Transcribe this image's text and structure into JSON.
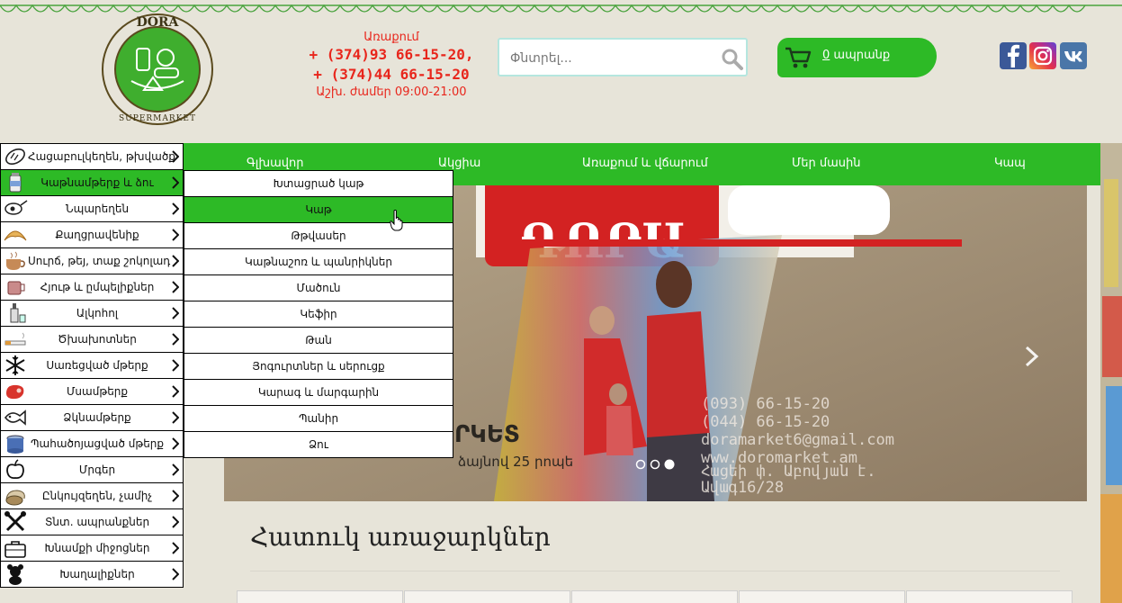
{
  "header": {
    "logo_text_top": "DORA",
    "logo_text_bottom": "SUPERMARKET",
    "delivery_label": "Առաքում",
    "phone_1": "+ (374)93 66-15-20,",
    "phone_2": "+ (374)44 66-15-20",
    "hours": "Աշխ. ժամեր 09:00-21:00",
    "search": {
      "placeholder": "Փնտրել..."
    },
    "cart": {
      "count": "0",
      "label": "ապրանք"
    },
    "social": [
      "facebook-icon",
      "instagram-icon",
      "vk-icon"
    ]
  },
  "nav": {
    "items": [
      "Գլխավոր",
      "Ակցիա",
      "Առաքում և վճարում",
      "Մեր մասին",
      "Կապ"
    ]
  },
  "categories": [
    {
      "label": "Հացաբուլկեղեն, թխվածք",
      "icon": "bread-icon"
    },
    {
      "label": "Կաթնամթերք և ձու",
      "icon": "milk-icon",
      "active": true
    },
    {
      "label": "Նպարեղեն",
      "icon": "grocery-icon"
    },
    {
      "label": "Քաղցրավենիք",
      "icon": "croissant-icon"
    },
    {
      "label": "Սուրճ, թեյ, տաք շոկոլադ",
      "icon": "coffee-icon"
    },
    {
      "label": "Հյութ և ըմպելիքներ",
      "icon": "juice-icon"
    },
    {
      "label": "Ալկոհոլ",
      "icon": "alcohol-icon"
    },
    {
      "label": "Ծխախոտներ",
      "icon": "cigarette-icon"
    },
    {
      "label": "Սառեցված մթերք",
      "icon": "snowflake-icon"
    },
    {
      "label": "Մսամթերք",
      "icon": "meat-icon"
    },
    {
      "label": "Ձկնամթերք",
      "icon": "fish-icon"
    },
    {
      "label": "Պահածոյացված մթերք",
      "icon": "canned-icon"
    },
    {
      "label": "Մրգեր",
      "icon": "apple-icon"
    },
    {
      "label": "Ընկույզեղեն, չամիչ",
      "icon": "nuts-icon"
    },
    {
      "label": "Տնտ. ապրանքներ",
      "icon": "tools-icon"
    },
    {
      "label": "Խնամքի միջոցներ",
      "icon": "care-icon"
    },
    {
      "label": "Խաղալիքներ",
      "icon": "toy-icon"
    }
  ],
  "submenu": [
    {
      "label": "Խտացրած կաթ"
    },
    {
      "label": "Կաթ",
      "active": true
    },
    {
      "label": "Թթվասեր"
    },
    {
      "label": "Կաթնաշոռ և պանրիկներ"
    },
    {
      "label": "Մածուն"
    },
    {
      "label": "Կեֆիր"
    },
    {
      "label": "Թան"
    },
    {
      "label": "Յոգուրտներ և սերուցք"
    },
    {
      "label": "Կարագ և մարգարին"
    },
    {
      "label": "Պանիր"
    },
    {
      "label": "Ձու"
    }
  ],
  "hero": {
    "phone_1": "(093) 66-15-20",
    "phone_2": "(044) 66-15-20",
    "email": "doramarket6@gmail.com",
    "site": "www.doromarket.am",
    "address_1": "Հացեի փ. Աբովյան է.",
    "address_2": "Ավագ16/28",
    "promo_text": "ՐԿԵՏ",
    "promo_sub": "ձայնով 25 րոպե",
    "slides": 3,
    "active_slide": 3
  },
  "offers": {
    "title": "Հատուկ առաջարկներ"
  },
  "colors": {
    "brand_green": "#2dba26",
    "accent_red": "#e8261c",
    "background": "#e7e4d9"
  }
}
